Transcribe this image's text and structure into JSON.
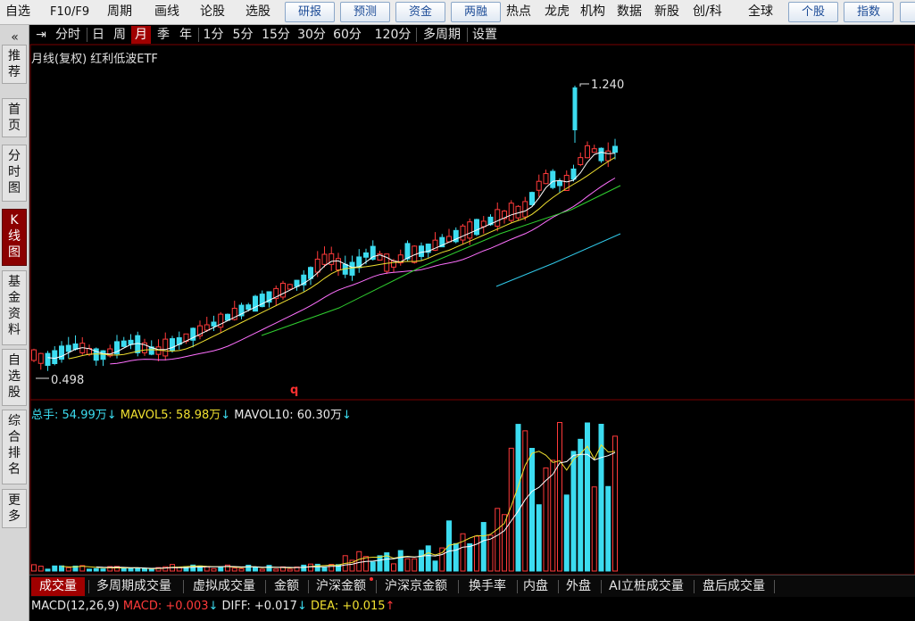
{
  "topbar": {
    "items": [
      "自选",
      "F10/F9",
      "周期",
      "画线",
      "论股",
      "选股",
      "研报",
      "预测",
      "资金",
      "两融",
      "热点",
      "龙虎",
      "机构",
      "数据",
      "新股",
      "创/科",
      "全球",
      "个股",
      "指数"
    ]
  },
  "sidebar": {
    "collapse": "«",
    "items": [
      {
        "label": "推荐",
        "active": false
      },
      {
        "label": "首页",
        "active": false
      },
      {
        "label": "分时图",
        "active": false
      },
      {
        "label": "K线图",
        "active": true
      },
      {
        "label": "基金资料",
        "active": false
      },
      {
        "label": "自选股",
        "active": false
      },
      {
        "label": "综合排名",
        "active": false
      },
      {
        "label": "更多",
        "active": false
      }
    ]
  },
  "period_bar": {
    "collapse_icon": "⇥",
    "items": [
      "分时",
      "日",
      "周",
      "月",
      "季",
      "年",
      "1分",
      "5分",
      "15分",
      "30分",
      "60分",
      "120分",
      "多周期",
      "设置"
    ],
    "active": "月"
  },
  "chart": {
    "title": "月线(复权) 红利低波ETF",
    "high_label": "1.240",
    "low_label": "0.498",
    "marker": "q",
    "colors": {
      "up": "#ff3a3a",
      "down": "#3cdcf0",
      "ma5": "#ffffff",
      "ma10": "#f0e030",
      "ma20": "#ff70ff",
      "ma40": "#30d030",
      "ma60": "#30c8e8"
    }
  },
  "volume_legend": {
    "total_label": "总手:",
    "total_value": "54.99万",
    "total_arrow": "↓",
    "ma5_label": "MAVOL5:",
    "ma5_value": "58.98万",
    "ma5_arrow": "↓",
    "ma10_label": "MAVOL10:",
    "ma10_value": "60.30万",
    "ma10_arrow": "↓"
  },
  "bottom_tabs": {
    "items": [
      "成交量",
      "多周期成交量",
      "虚拟成交量",
      "金额",
      "沪深金额",
      "沪深京金额",
      "换手率",
      "内盘",
      "外盘",
      "AI立桩成交量",
      "盘后成交量"
    ],
    "active": "成交量"
  },
  "macd_legend": {
    "name": "MACD(12,26,9)",
    "macd_label": "MACD:",
    "macd_value": "+0.003",
    "macd_arrow": "↓",
    "diff_label": "DIFF:",
    "diff_value": "+0.017",
    "diff_arrow": "↓",
    "dea_label": "DEA:",
    "dea_value": "+0.015",
    "dea_arrow": "↑"
  }
}
